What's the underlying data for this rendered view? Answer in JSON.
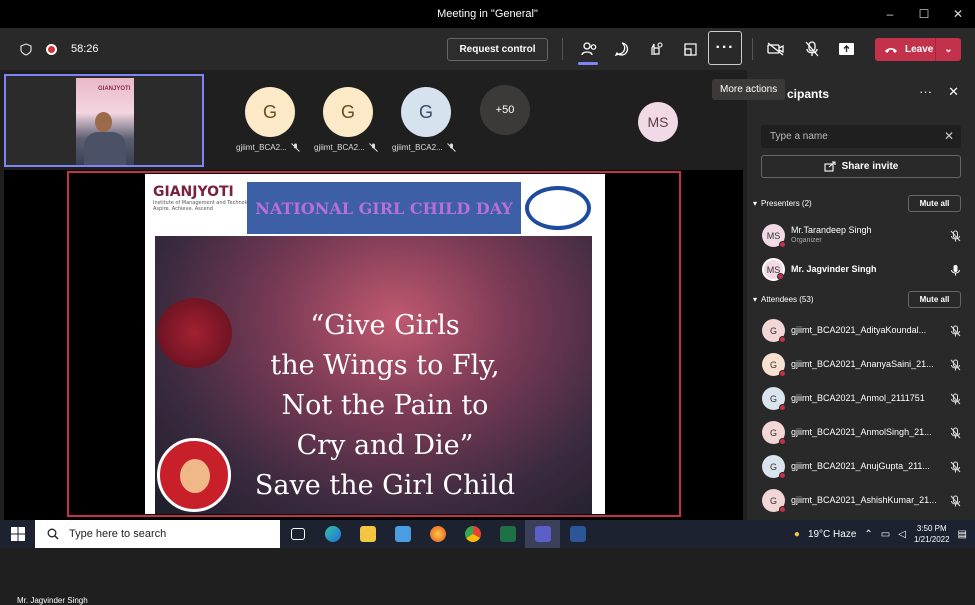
{
  "window": {
    "title": "Meeting in \"General\"",
    "controls": [
      "–",
      "☐",
      "✕"
    ]
  },
  "toolbar": {
    "timer": "58:26",
    "request_control": "Request control",
    "more_actions_tooltip": "More actions",
    "more_label": "···",
    "leave": "Leave"
  },
  "gallery": {
    "tiles": [
      {
        "initial": "G",
        "label": "gjiimt_BCA2..."
      },
      {
        "initial": "G",
        "label": "gjiimt_BCA2..."
      },
      {
        "initial": "G",
        "label": "gjiimt_BCA2..."
      }
    ],
    "overflow": "+50",
    "ms_tile": "MS"
  },
  "self_view": {
    "brand": "GIANJYOTI"
  },
  "slide": {
    "logo": "GIANJYOTI",
    "logo_sub": "Institute of Management and Technology",
    "tagline": "Aspire. Achieve. Ascend",
    "banner": "NATIONAL GIRL CHILD DAY",
    "quote_lines": [
      "“Give Girls",
      "the Wings to Fly,",
      "Not the Pain to",
      "Cry and Die”",
      "Save the Girl Child"
    ]
  },
  "speaker_name": "Mr. Jagvinder Singh",
  "panel": {
    "title": "cipants",
    "search_placeholder": "Type a name",
    "share_invite": "Share invite",
    "presenters_header": "Presenters (2)",
    "attendees_header": "Attendees (53)",
    "mute_all": "Mute all",
    "presenters": [
      {
        "initials": "MS",
        "name": "Mr.Tarandeep Singh",
        "role": "Organizer"
      },
      {
        "initials": "MS",
        "name": "Mr. Jagvinder Singh",
        "role": ""
      }
    ],
    "attendees": [
      {
        "initial": "G",
        "name": "gjiimt_BCA2021_AdityaKoundal...",
        "color": "#f3d6d6"
      },
      {
        "initial": "G",
        "name": "gjiimt_BCA2021_AnanyaSaini_21...",
        "color": "#f8e1d0"
      },
      {
        "initial": "G",
        "name": "gjiimt_BCA2021_Anmol_2111751",
        "color": "#d9e4ee"
      },
      {
        "initial": "G",
        "name": "gjiimt_BCA2021_AnmolSingh_21...",
        "color": "#f3d6d6"
      },
      {
        "initial": "G",
        "name": "gjiimt_BCA2021_AnujGupta_211...",
        "color": "#d9e4ee"
      },
      {
        "initial": "G",
        "name": "gjiimt_BCA2021_AshishKumar_21...",
        "color": "#f3d6d6"
      }
    ]
  },
  "taskbar": {
    "search_placeholder": "Type here to search",
    "weather": "19°C  Haze",
    "time": "3:50 PM",
    "date": "1/21/2022"
  },
  "colors": {
    "leave": "#c4314b",
    "self_view_border": "#7f85f5",
    "share_border": "#c4314b"
  }
}
